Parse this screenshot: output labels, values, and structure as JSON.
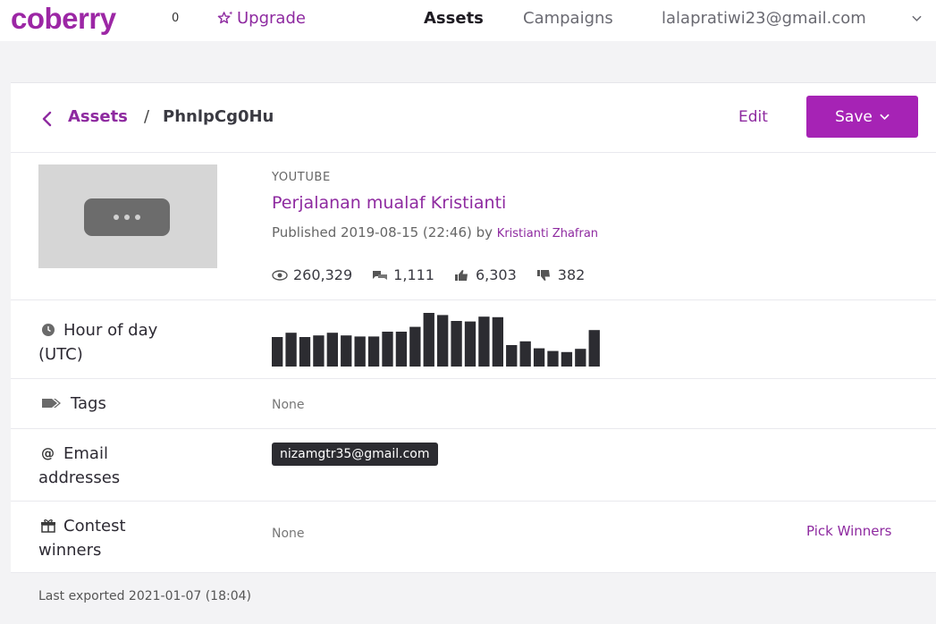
{
  "topbar": {
    "logo": "coberry",
    "notification_count": "0",
    "upgrade_label": "Upgrade",
    "nav": {
      "assets": "Assets",
      "campaigns": "Campaigns"
    },
    "user_email": "lalapratiwi23@gmail.com"
  },
  "breadcrumb": {
    "parent": "Assets",
    "separator": "/",
    "current": "PhnlpCg0Hu"
  },
  "actions": {
    "edit": "Edit",
    "save": "Save"
  },
  "video": {
    "platform": "YOUTUBE",
    "title": "Perjalanan mualaf Kristianti",
    "published_prefix": "Published 2019-08-15 (22:46) by ",
    "author": "Kristianti Zhafran",
    "stats": {
      "views": "260,329",
      "comments": "1,111",
      "likes": "6,303",
      "dislikes": "382"
    }
  },
  "fields": {
    "hour_of_day": {
      "label_line1": "Hour of day",
      "label_line2": "(UTC)"
    },
    "tags": {
      "label": "Tags",
      "value": "None"
    },
    "emails": {
      "label_line1": "Email",
      "label_line2": "addresses",
      "values": [
        "nizamgtr35@gmail.com"
      ]
    },
    "contest": {
      "label_line1": "Contest",
      "label_line2": "winners",
      "value": "None",
      "action": "Pick Winners"
    }
  },
  "footer": {
    "last_exported": "Last exported 2021-01-07 (18:04)"
  },
  "colors": {
    "brand": "#9c27a5",
    "accent": "#a623b5",
    "bar": "#2c2c31"
  },
  "chart_data": {
    "type": "bar",
    "categories": [
      "0",
      "1",
      "2",
      "3",
      "4",
      "5",
      "6",
      "7",
      "8",
      "9",
      "10",
      "11",
      "12",
      "13",
      "14",
      "15",
      "16",
      "17",
      "18",
      "19",
      "20",
      "21",
      "22",
      "23"
    ],
    "values": [
      0.55,
      0.63,
      0.55,
      0.58,
      0.63,
      0.58,
      0.56,
      0.56,
      0.65,
      0.65,
      0.74,
      1.0,
      0.96,
      0.85,
      0.84,
      0.93,
      0.92,
      0.4,
      0.47,
      0.34,
      0.29,
      0.27,
      0.33,
      0.68
    ],
    "ylim": [
      0,
      1
    ],
    "xlabel": "",
    "ylabel": "",
    "title": "",
    "grid": false
  }
}
